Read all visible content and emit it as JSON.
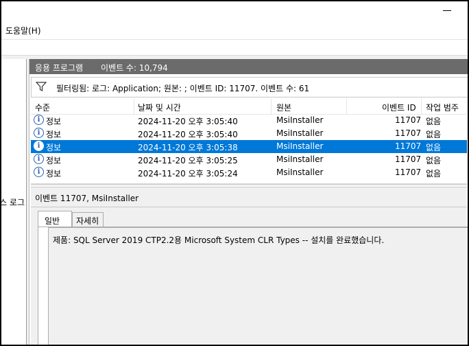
{
  "menu": {
    "help": "도움말(H)"
  },
  "left_pane": {
    "label": "스 로그"
  },
  "header": {
    "title": "응용 프로그램",
    "count_label": "이벤트 수: 10,794"
  },
  "filter": {
    "text": "필터링됨: 로그: Application; 원본: ; 이벤트 ID: 11707. 이벤트 수: 61"
  },
  "columns": [
    "수준",
    "날짜 및 시간",
    "원본",
    "이벤트 ID",
    "작업 범주"
  ],
  "events": [
    {
      "level": "정보",
      "datetime": "2024-11-20 오후 3:05:40",
      "source": "MsiInstaller",
      "event_id": "11707",
      "category": "없음",
      "selected": false
    },
    {
      "level": "정보",
      "datetime": "2024-11-20 오후 3:05:40",
      "source": "MsiInstaller",
      "event_id": "11707",
      "category": "없음",
      "selected": false
    },
    {
      "level": "정보",
      "datetime": "2024-11-20 오후 3:05:38",
      "source": "MsiInstaller",
      "event_id": "11707",
      "category": "없음",
      "selected": true
    },
    {
      "level": "정보",
      "datetime": "2024-11-20 오후 3:05:25",
      "source": "MsiInstaller",
      "event_id": "11707",
      "category": "없음",
      "selected": false
    },
    {
      "level": "정보",
      "datetime": "2024-11-20 오후 3:05:24",
      "source": "MsiInstaller",
      "event_id": "11707",
      "category": "없음",
      "selected": false
    }
  ],
  "detail": {
    "title": "이벤트 11707, MsiInstaller",
    "tabs": [
      "일반",
      "자세히"
    ],
    "description": "제품: SQL Server 2019 CTP2.2용 Microsoft System CLR Types -- 설치를 완료했습니다."
  },
  "colors": {
    "selection": "#0078d7",
    "header_bg": "#6b6b6b",
    "info_icon": "#2a5caa"
  }
}
